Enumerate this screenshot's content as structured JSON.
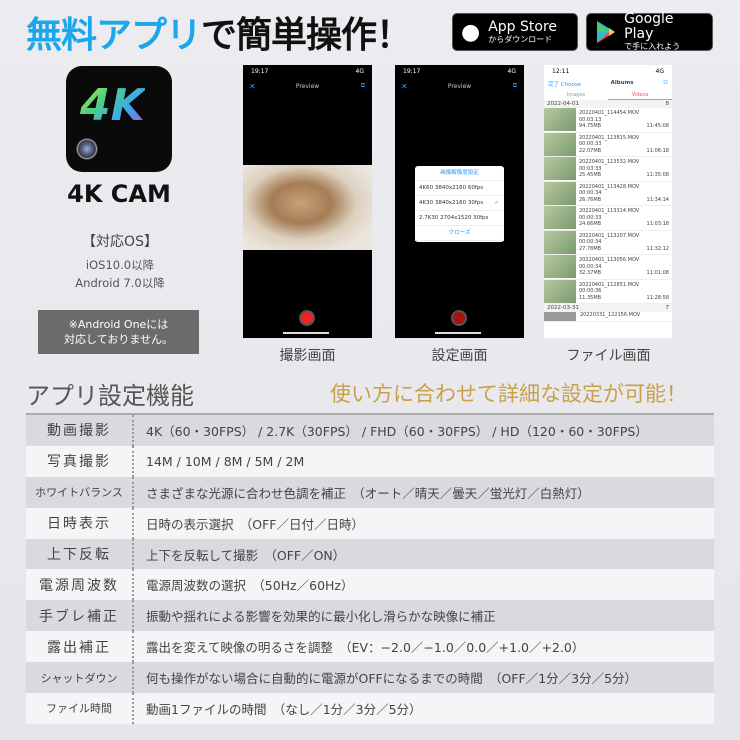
{
  "headline": {
    "blue": "無料アプリ",
    "black": "で簡単操作！"
  },
  "stores": [
    {
      "name": "App Store",
      "sub": "からダウンロード",
      "icon": "apple-icon"
    },
    {
      "name": "Google Play",
      "sub": "で手に入れよう",
      "icon": "google-play-icon"
    }
  ],
  "app": {
    "icon_text": "4K",
    "name": "4K CAM"
  },
  "os": {
    "heading": "【対応OS】",
    "ios": "iOS10.0以降",
    "android": "Android 7.0以降"
  },
  "note": {
    "line1": "※Android Oneには",
    "line2": "対応しておりません。"
  },
  "phone1": {
    "time": "19:17",
    "signal": "4G",
    "title": "Preview",
    "caption": "撮影画面"
  },
  "phone2": {
    "time": "19:17",
    "signal": "4G",
    "title": "Preview",
    "dialog_title": "画像解像度設定",
    "options": [
      "4K60 3840x2160 60fps",
      "4K30 3840x2160 30fps",
      "2.7K30 2704x1520 30fps"
    ],
    "selected": "4K30 3840x2160 30fps",
    "close": "クローズ",
    "caption": "設定画面"
  },
  "phone3": {
    "time": "12:11",
    "signal": "4G",
    "back": "完了",
    "choose": "Choose",
    "title": "Albums",
    "tabs": [
      "Images",
      "Videos"
    ],
    "active_tab": "Videos",
    "group1": {
      "date": "2022-04-01",
      "count": "8"
    },
    "files": [
      {
        "name": "20220401_114454.MOV",
        "dur": "00:03:13",
        "size": "94.75MB",
        "time": "11:45:08"
      },
      {
        "name": "20220401_113815.MOV",
        "dur": "00:00:33",
        "size": "22.07MB",
        "time": "11:06:18"
      },
      {
        "name": "20220401_113532.MOV",
        "dur": "00:03:33",
        "size": "25.45MB",
        "time": "11:35:08"
      },
      {
        "name": "20220401_113428.MOV",
        "dur": "00:00:34",
        "size": "26.76MB",
        "time": "11:34:14"
      },
      {
        "name": "20220401_113314.MOV",
        "dur": "00:00:33",
        "size": "24.66MB",
        "time": "11:03:18"
      },
      {
        "name": "20220401_113207.MOV",
        "dur": "00:00:34",
        "size": "27.78MB",
        "time": "11:32:12"
      },
      {
        "name": "20220401_113056.MOV",
        "dur": "00:00:34",
        "size": "32.37MB",
        "time": "11:01:08"
      },
      {
        "name": "20220401_112851.MOV",
        "dur": "00:00:36",
        "size": "11.35MB",
        "time": "11:28:58"
      }
    ],
    "group2": {
      "date": "2022-03-31",
      "count": "7"
    },
    "last_file": "20220331_122156.MOV",
    "caption": "ファイル画面"
  },
  "section": {
    "title": "アプリ設定機能",
    "tagline": "使い方に合わせて詳細な設定が可能！"
  },
  "features": [
    {
      "label": "動画撮影",
      "value": "4K（60・30FPS） / 2.7K（30FPS） / FHD（60・30FPS） / HD（120・60・30FPS）"
    },
    {
      "label": "写真撮影",
      "value": "14M / 10M / 8M / 5M / 2M"
    },
    {
      "label": "ホワイトバランス",
      "value": "さまざまな光源に合わせ色調を補正　（オート／晴天／曇天／蛍光灯／白熱灯）"
    },
    {
      "label": "日時表示",
      "value": "日時の表示選択　（OFF／日付／日時）"
    },
    {
      "label": "上下反転",
      "value": "上下を反転して撮影　（OFF／ON）"
    },
    {
      "label": "電源周波数",
      "value": "電源周波数の選択　（50Hz／60Hz）"
    },
    {
      "label": "手ブレ補正",
      "value": "振動や揺れによる影響を効果的に最小化し滑らかな映像に補正"
    },
    {
      "label": "露出補正",
      "value": "露出を変えて映像の明るさを調整　（EV：−2.0／−1.0／0.0／+1.0／+2.0）"
    },
    {
      "label": "シャットダウン",
      "value": "何も操作がない場合に自動的に電源がOFFになるまでの時間　（OFF／1分／3分／5分）"
    },
    {
      "label": "ファイル時間",
      "value": "動画1ファイルの時間　（なし／1分／3分／5分）"
    }
  ]
}
